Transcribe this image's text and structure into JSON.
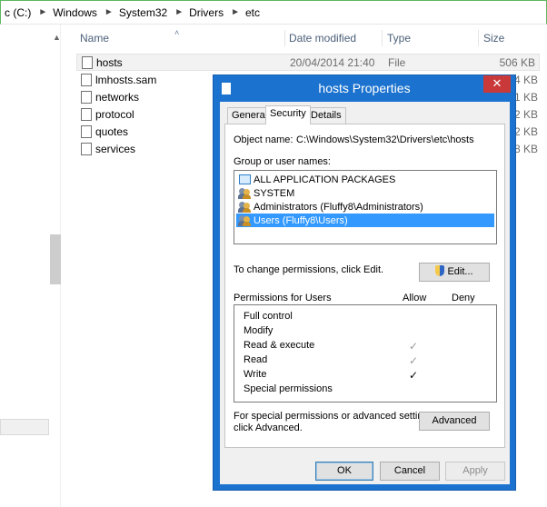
{
  "address_bar": {
    "segments": [
      "c (C:)",
      "Windows",
      "System32",
      "Drivers",
      "etc"
    ]
  },
  "columns": {
    "name": "Name",
    "date_modified": "Date modified",
    "type": "Type",
    "size": "Size"
  },
  "files": [
    {
      "name": "hosts",
      "date": "20/04/2014 21:40",
      "type": "File",
      "size": "506 KB",
      "selected": true
    },
    {
      "name": "lmhosts.sam",
      "date": "",
      "type": "",
      "size": "4 KB"
    },
    {
      "name": "networks",
      "date": "",
      "type": "",
      "size": "1 KB"
    },
    {
      "name": "protocol",
      "date": "",
      "type": "",
      "size": "2 KB"
    },
    {
      "name": "quotes",
      "date": "",
      "type": "",
      "size": "2 KB"
    },
    {
      "name": "services",
      "date": "",
      "type": "",
      "size": "8 KB"
    }
  ],
  "dialog": {
    "title": "hosts Properties",
    "close_label": "✕",
    "tabs": [
      "General",
      "Security",
      "Details"
    ],
    "active_tab": "Security",
    "object_name_label": "Object name:",
    "object_name_value": "C:\\Windows\\System32\\Drivers\\etc\\hosts",
    "group_label": "Group or user names:",
    "groups": [
      {
        "name": "ALL APPLICATION PACKAGES",
        "icon": "package-icon"
      },
      {
        "name": "SYSTEM",
        "icon": "users-icon"
      },
      {
        "name": "Administrators (Fluffy8\\Administrators)",
        "icon": "users-icon"
      },
      {
        "name": "Users (Fluffy8\\Users)",
        "icon": "users-icon",
        "selected": true
      }
    ],
    "change_perm_text": "To change permissions, click Edit.",
    "edit_button": "Edit...",
    "permissions_header": "Permissions for Users",
    "allow_header": "Allow",
    "deny_header": "Deny",
    "permissions": [
      {
        "name": "Full control",
        "allow": ""
      },
      {
        "name": "Modify",
        "allow": ""
      },
      {
        "name": "Read & execute",
        "allow": "✓",
        "inherited": true
      },
      {
        "name": "Read",
        "allow": "✓",
        "inherited": true
      },
      {
        "name": "Write",
        "allow": "✓",
        "inherited": false
      },
      {
        "name": "Special permissions",
        "allow": ""
      }
    ],
    "special_text_1": "For special permissions or advanced settings,",
    "special_text_2": "click Advanced.",
    "advanced_button": "Advanced",
    "ok_button": "OK",
    "cancel_button": "Cancel",
    "apply_button": "Apply"
  },
  "colors": {
    "titlebar": "#1c73cf",
    "close": "#c9393a",
    "selection": "#3399ff"
  }
}
